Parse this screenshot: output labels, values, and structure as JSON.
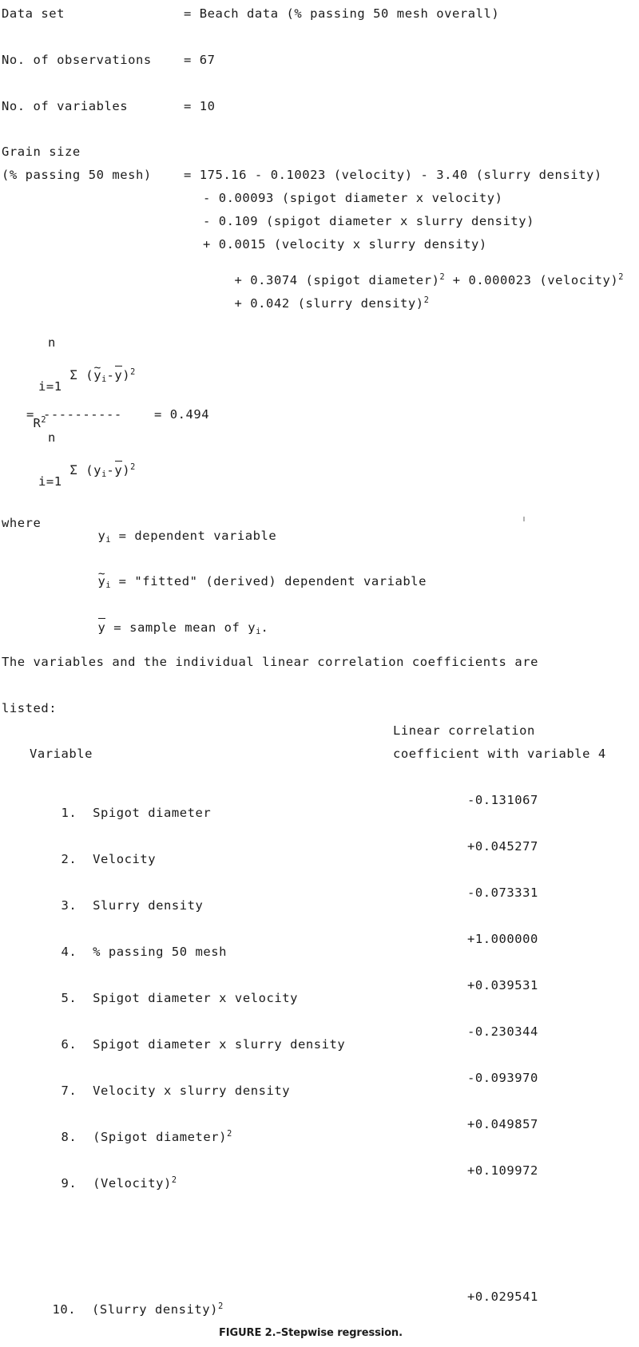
{
  "document": {
    "type": "scanned-technical-report-page",
    "figure_caption": "FIGURE 2.–Stepwise regression."
  },
  "header": {
    "dataset_label": "Data set",
    "dataset_value": "= Beach data (% passing 50 mesh overall)",
    "observations_label": "No. of observations",
    "observations_value": "= 67",
    "variables_label": "No. of variables",
    "variables_value": "= 10"
  },
  "equation": {
    "lhs_line1": "Grain size",
    "lhs_line2": "(% passing 50 mesh)",
    "rhs_line1": "= 175.16 - 0.10023 (velocity) - 3.40 (slurry density)",
    "rhs_line2": "- 0.00093 (spigot diameter x velocity)",
    "rhs_line3": "- 0.109 (spigot diameter x slurry density)",
    "rhs_line4": "+ 0.0015 (velocity x slurry density)",
    "rhs_line5_a": "+ 0.3074 (spigot diameter)",
    "rhs_line5_exp": "2",
    "rhs_line5_b": " + 0.000023 (velocity)",
    "rhs_line5_exp2": "2",
    "rhs_line6_a": "+ 0.042 (slurry density)",
    "rhs_line6_exp": "2"
  },
  "r_squared": {
    "symbol": "R",
    "symbol_exp": "2",
    "equals": "=",
    "numerator_top": "n",
    "numerator_sum": "Σ (",
    "numerator_y_tilde": "y",
    "numerator_sub_i": "i",
    "numerator_minus": "-",
    "numerator_ybar": "y",
    "numerator_close": ")",
    "numerator_exp": "2",
    "numerator_bottom": "i=1",
    "fraction_bar": "----------",
    "result_equals": "= 0.494",
    "denominator_top": "n",
    "denominator_sum": "Σ (y",
    "denominator_sub_i": "i",
    "denominator_minus": "-",
    "denominator_ybar": "y",
    "denominator_close": ")",
    "denominator_exp": "2",
    "denominator_bottom": "i=1"
  },
  "where_block": {
    "where_label": "where",
    "def1_sym": "y",
    "def1_sub": "i",
    "def1_text": " = dependent variable",
    "def2_sym": "y",
    "def2_sub": "i",
    "def2_text": " = \"fitted\" (derived) dependent variable",
    "def3_sym": "y",
    "def3_text_a": " = sample mean of y",
    "def3_sub": "i",
    "def3_text_b": "."
  },
  "paragraph": {
    "line1": "The variables and the individual linear correlation coefficients are",
    "line2": "listed:"
  },
  "table": {
    "col1_header": "Variable",
    "col2_header_line1": "Linear correlation",
    "col2_header_line2": "coefficient with variable 4",
    "rows": [
      {
        "num": "1.",
        "name": "Spigot diameter",
        "exp": "",
        "coefficient": "-0.131067"
      },
      {
        "num": "2.",
        "name": "Velocity",
        "exp": "",
        "coefficient": "+0.045277"
      },
      {
        "num": "3.",
        "name": "Slurry density",
        "exp": "",
        "coefficient": "-0.073331"
      },
      {
        "num": "4.",
        "name": "% passing 50 mesh",
        "exp": "",
        "coefficient": "+1.000000"
      },
      {
        "num": "5.",
        "name": "Spigot diameter x velocity",
        "exp": "",
        "coefficient": "+0.039531"
      },
      {
        "num": "6.",
        "name": "Spigot diameter x slurry density",
        "exp": "",
        "coefficient": "-0.230344"
      },
      {
        "num": "7.",
        "name": "Velocity x slurry density",
        "exp": "",
        "coefficient": "-0.093970"
      },
      {
        "num": "8.",
        "name": "(Spigot diameter)",
        "exp": "2",
        "coefficient": "+0.049857"
      },
      {
        "num": "9.",
        "name": "(Velocity)",
        "exp": "2",
        "coefficient": "+0.109972"
      },
      {
        "num": "10.",
        "name": "(Slurry density)",
        "exp": "2",
        "coefficient": "+0.029541"
      }
    ]
  },
  "colors": {
    "ink": "#1b1b1b",
    "paper": "#ffffff"
  }
}
